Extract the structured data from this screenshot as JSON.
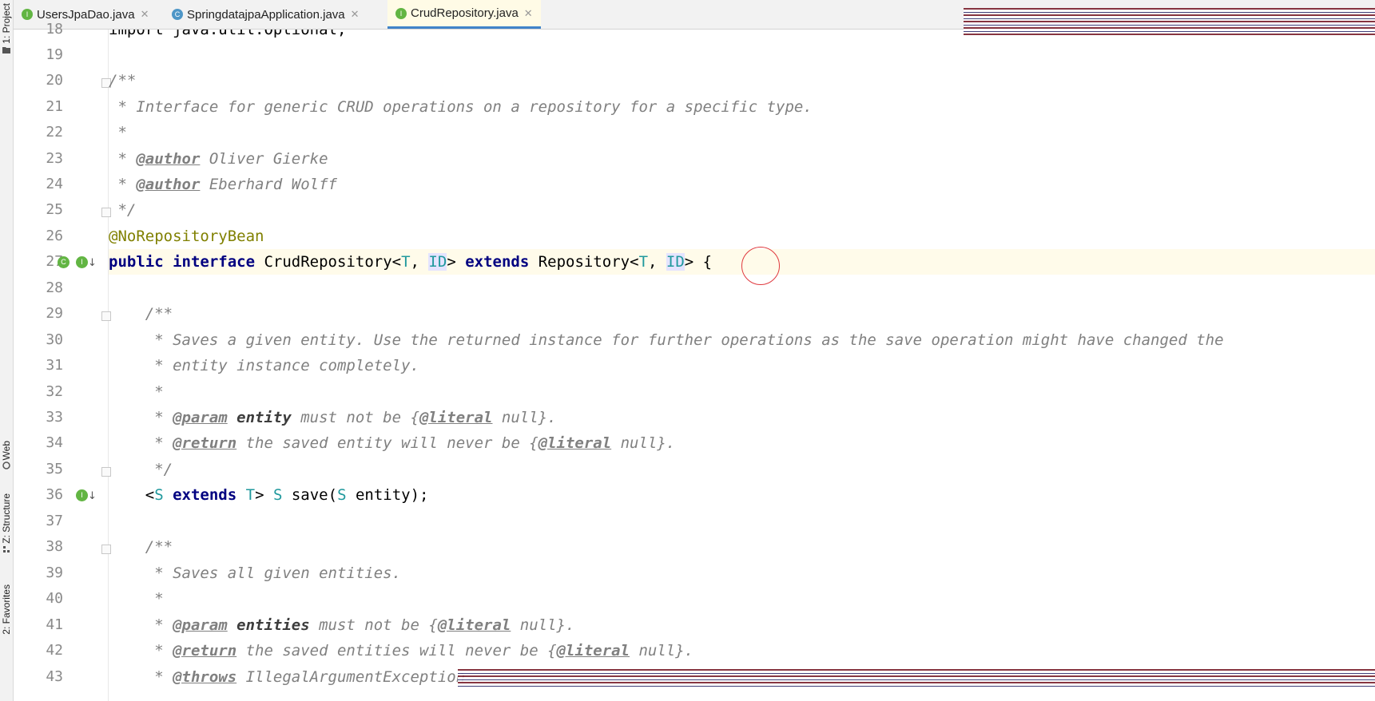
{
  "toolstrip": {
    "project": "1: Project",
    "web": "Web",
    "structure": "Z: Structure",
    "favorites": "2: Favorites"
  },
  "tabs": [
    {
      "label": "UsersJpaDao.java",
      "icon": "interface-icon",
      "active": false
    },
    {
      "label": "SpringdatajpaApplication.java",
      "icon": "class-icon",
      "active": false
    },
    {
      "label": "CrudRepository.java",
      "icon": "interface-icon",
      "active": true
    }
  ],
  "editor": {
    "line_numbers": [
      "18",
      "19",
      "20",
      "21",
      "22",
      "23",
      "24",
      "25",
      "26",
      "27",
      "28",
      "29",
      "30",
      "31",
      "32",
      "33",
      "34",
      "35",
      "36",
      "37",
      "38",
      "39",
      "40",
      "41",
      "42",
      "43"
    ],
    "lines": {
      "l18": "import java.util.Optional;",
      "l20": "/**",
      "l21": " * Interface for generic CRUD operations on a repository for a specific type.",
      "l22": " *",
      "l23_a": " * ",
      "l23_tag": "@author",
      "l23_b": " Oliver Gierke",
      "l24_a": " * ",
      "l24_tag": "@author",
      "l24_b": " Eberhard Wolff",
      "l25": " */",
      "l26": "@NoRepositoryBean",
      "l27_public": "public",
      "l27_interface": "interface",
      "l27_name": " CrudRepository<",
      "l27_T1": "T",
      "l27_comma1": ", ",
      "l27_ID1": "ID",
      "l27_gt1": "> ",
      "l27_extends": "extends",
      "l27_repo": " Repository<",
      "l27_T2": "T",
      "l27_comma2": ", ",
      "l27_ID2": "ID",
      "l27_end": "> {",
      "l29": "    /**",
      "l30": "     * Saves a given entity. Use the returned instance for further operations as the save operation might have changed the",
      "l31": "     * entity instance completely.",
      "l32": "     *",
      "l33_a": "     * ",
      "l33_tag": "@param",
      "l33_p": " entity",
      "l33_b": " must not be {",
      "l33_lit": "@literal",
      "l33_c": " null}.",
      "l34_a": "     * ",
      "l34_tag": "@return",
      "l34_b": " the saved entity will never be {",
      "l34_lit": "@literal",
      "l34_c": " null}.",
      "l35": "     */",
      "l36_lt": "    <",
      "l36_S1": "S",
      "l36_sp": " ",
      "l36_extends": "extends",
      "l36_T": " T",
      "l36_gt": "> ",
      "l36_S2": "S",
      "l36_save": " save(",
      "l36_S3": "S",
      "l36_end": " entity);",
      "l38": "    /**",
      "l39": "     * Saves all given entities.",
      "l40": "     *",
      "l41_a": "     * ",
      "l41_tag": "@param",
      "l41_p": " entities",
      "l41_b": " must not be {",
      "l41_lit": "@literal",
      "l41_c": " null}.",
      "l42_a": "     * ",
      "l42_tag": "@return",
      "l42_b": " the saved entities will never be {",
      "l42_lit": "@literal",
      "l42_c": " null}.",
      "l43_a": "     * ",
      "l43_tag": "@throws",
      "l43_b": " IllegalArgumentException"
    }
  },
  "colors": {
    "keyword": "#000080",
    "comment": "#808080",
    "annotation": "#808000",
    "type_param": "#20999d",
    "current_line": "#fffbea",
    "highlight_circle": "#e0393e",
    "active_tab_underline": "#4083c9"
  }
}
